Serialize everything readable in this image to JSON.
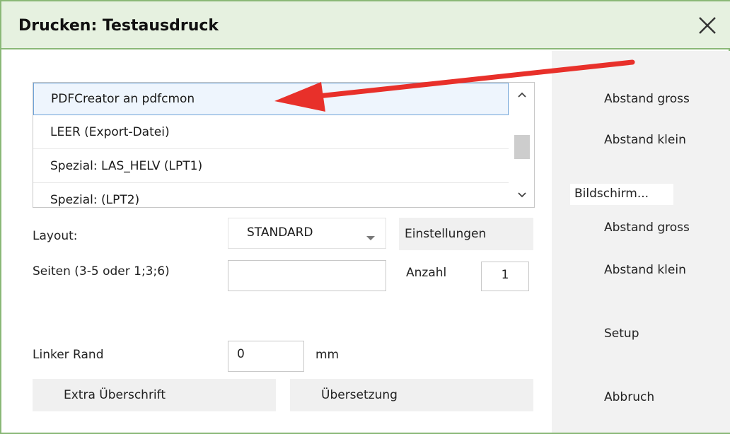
{
  "window": {
    "title": "Drucken: Testausdruck",
    "close_icon": "close-icon"
  },
  "printer_list": {
    "items": [
      {
        "label": "PDFCreator an pdfcmon",
        "selected": true
      },
      {
        "label": "LEER (Export-Datei)",
        "selected": false
      },
      {
        "label": "Spezial: LAS_HELV (LPT1)",
        "selected": false
      },
      {
        "label": "Spezial:  (LPT2)",
        "selected": false
      }
    ],
    "scroll_up_icon": "chevron-up-icon",
    "scroll_down_icon": "chevron-down-icon"
  },
  "form": {
    "layout_label": "Layout:",
    "layout_value": "STANDARD",
    "einstellungen_label": "Einstellungen",
    "seiten_label": "Seiten (3-5 oder 1;3;6)",
    "seiten_value": "",
    "anzahl_label": "Anzahl",
    "anzahl_value": "1",
    "linker_rand_label": "Linker Rand",
    "linker_rand_value": "0",
    "mm_label": "mm",
    "extra_ueberschrift_label": "Extra Überschrift",
    "uebersetzung_label": "Übersetzung"
  },
  "right_panel": {
    "abstand_gross_1": "Abstand gross",
    "abstand_klein_1": "Abstand klein",
    "bildschirm": "Bildschirm...",
    "abstand_gross_2": "Abstand gross",
    "abstand_klein_2": "Abstand klein",
    "setup": "Setup",
    "abbruch": "Abbruch"
  },
  "colors": {
    "title_bg": "#e6f1e0",
    "border_green": "#8ab877",
    "annotation_arrow": "#e8302a"
  }
}
